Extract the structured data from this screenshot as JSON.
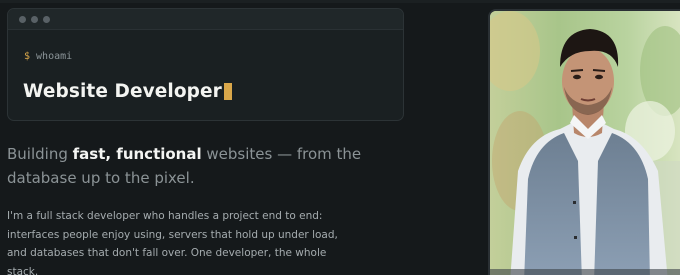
{
  "terminal": {
    "prompt_symbol": "$",
    "command": "whoami",
    "title": "Website Developer"
  },
  "hero": {
    "headline_part1": "Building ",
    "headline_bold": "fast, functional",
    "headline_part2": " websites — from the database up to the pixel.",
    "bio": "I'm a full stack developer who handles a project end to end: interfaces people enjoy using, servers that hold up under load, and databases that don't fall over. One developer, the whole stack."
  },
  "colors": {
    "background": "#15191b",
    "accent": "#d9a74a",
    "terminal_bg": "#1a2022"
  },
  "icons": {
    "window_dots": [
      "window-dot-icon",
      "window-dot-icon",
      "window-dot-icon"
    ],
    "cursor": "block-cursor-icon"
  }
}
